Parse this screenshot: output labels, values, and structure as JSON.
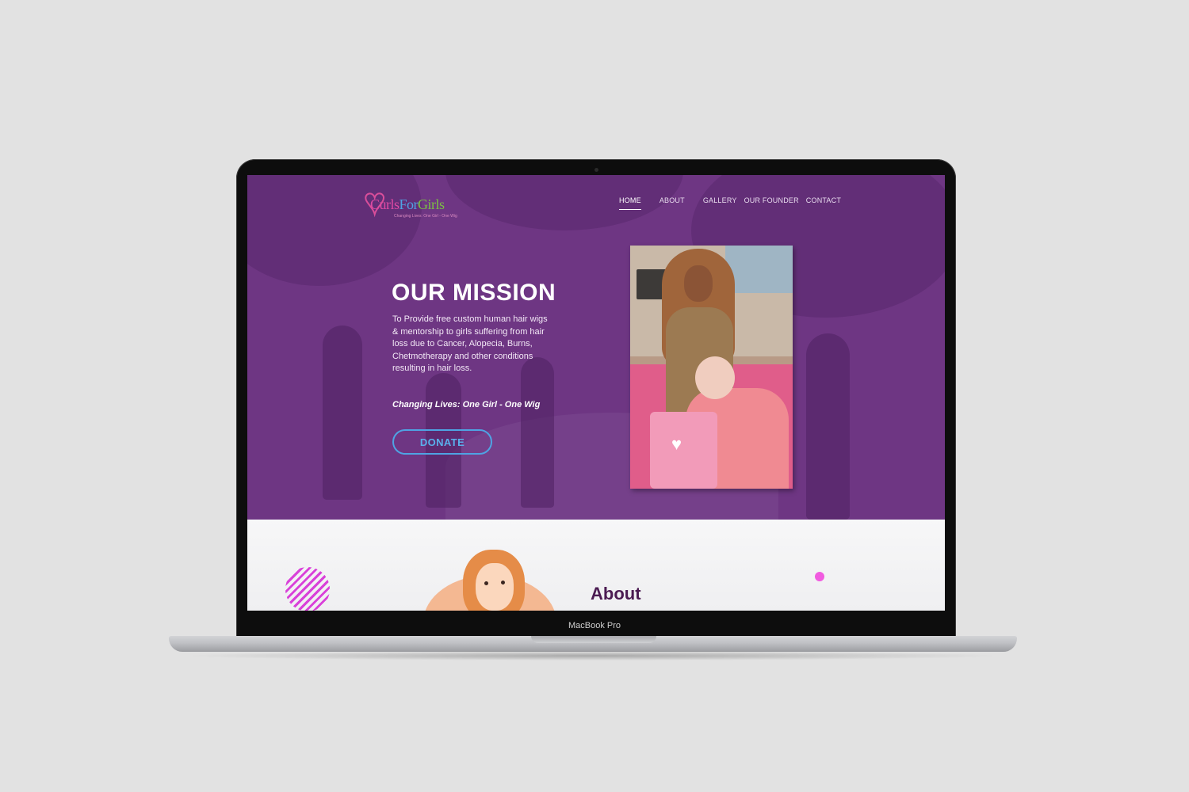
{
  "device": {
    "label": "MacBook Pro"
  },
  "site": {
    "logo": {
      "part1": "Curls",
      "part2": "For",
      "part3": "Girls",
      "tagline": "Changing Lives: One Girl - One Wig"
    },
    "nav": [
      {
        "label": "HOME",
        "active": true
      },
      {
        "label": "ABOUT",
        "active": false
      },
      {
        "label": "GALLERY",
        "active": false
      },
      {
        "label": "OUR FOUNDER",
        "active": false
      },
      {
        "label": "CONTACT",
        "active": false
      }
    ],
    "hero": {
      "title": "OUR MISSION",
      "text": "To Provide free custom human hair wigs & mentorship to girls suffering from hair loss due to Cancer, Alopecia, Burns, Chetmotherapy and other conditions resulting in hair loss.",
      "tagline": "Changing Lives: One Girl - One Wig",
      "donate_label": "DONATE"
    },
    "about": {
      "title": "About"
    }
  },
  "colors": {
    "hero_bg": "#6e3683",
    "accent_blue": "#4fa3e3",
    "about_title": "#4b1b52",
    "accent_pink": "#f15be0"
  }
}
